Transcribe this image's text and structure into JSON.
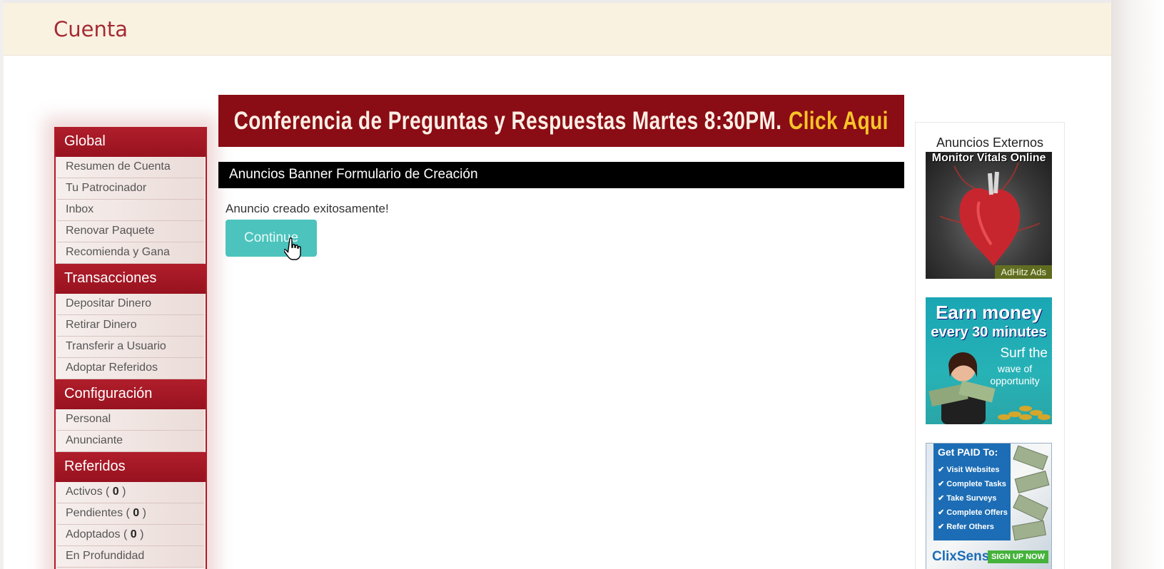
{
  "header": {
    "title": "Cuenta"
  },
  "sidebar": {
    "sections": [
      {
        "title": "Global",
        "items": [
          {
            "label": "Resumen de Cuenta"
          },
          {
            "label": "Tu Patrocinador"
          },
          {
            "label": "Inbox"
          },
          {
            "label": "Renovar Paquete"
          },
          {
            "label": "Recomienda y Gana"
          }
        ]
      },
      {
        "title": "Transacciones",
        "items": [
          {
            "label": "Depositar Dinero"
          },
          {
            "label": "Retirar Dinero"
          },
          {
            "label": "Transferir a Usuario"
          },
          {
            "label": "Adoptar Referidos"
          }
        ]
      },
      {
        "title": "Configuración",
        "items": [
          {
            "label": "Personal"
          },
          {
            "label": "Anunciante"
          }
        ]
      },
      {
        "title": "Referidos",
        "items": [
          {
            "label": "Activos ( ",
            "count": "0",
            "suffix": " )"
          },
          {
            "label": "Pendientes ( ",
            "count": "0",
            "suffix": " )"
          },
          {
            "label": "Adoptados ( ",
            "count": "0",
            "suffix": " )"
          },
          {
            "label": "En Profundidad"
          }
        ]
      }
    ]
  },
  "main": {
    "promo": {
      "text": "Conferencia de Preguntas y Respuestas Martes 8:30PM.",
      "cta": "Click Aqui"
    },
    "form_title": "Anuncios Banner Formulario de Creación",
    "success_message": "Anuncio creado exitosamente!",
    "continue_label": "Continue"
  },
  "ads": {
    "title": "Anuncios Externos",
    "ad1": {
      "headline": "Monitor Vitals Online",
      "footer": "AdHitz Ads"
    },
    "ad2": {
      "line1": "Earn money",
      "line2": "every 30 minutes",
      "line3": "Surf the",
      "line4": "wave of opportunity"
    },
    "ad3": {
      "heading": "Get PAID To:",
      "items": [
        "Visit Websites",
        "Complete Tasks",
        "Take Surveys",
        "Complete Offers",
        "Refer Others"
      ],
      "brand": "ClixSense",
      "cta": "SIGN UP NOW"
    }
  },
  "colors": {
    "brand_red": "#98121f",
    "promo_bg": "#8a0c14",
    "cta_yellow": "#f8c42a",
    "teal_button": "#4cc3bd",
    "header_bg": "#faf2e1"
  }
}
